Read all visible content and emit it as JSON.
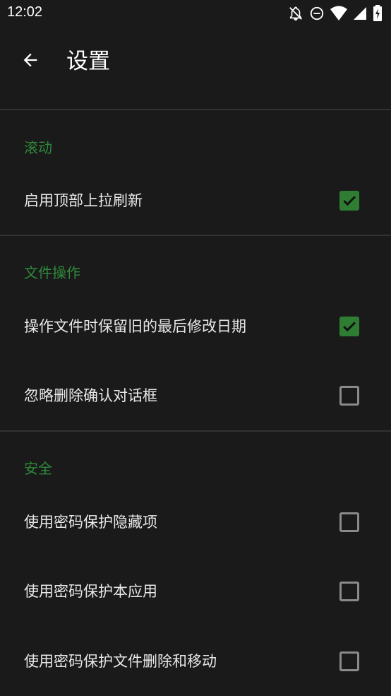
{
  "status_bar": {
    "time": "12:02",
    "icons": [
      "notifications-off-icon",
      "do-not-disturb-icon",
      "wifi-icon",
      "cell-signal-icon",
      "battery-charging-icon"
    ]
  },
  "app_bar": {
    "title": "设置",
    "back_icon": "arrow-back-icon"
  },
  "colors": {
    "background": "#1a1a1a",
    "accent": "#2f8a3b",
    "checkbox_checked": "#2e7d32",
    "divider": "#323232"
  },
  "sections": [
    {
      "header": "滚动",
      "items": [
        {
          "label": "启用顶部上拉刷新",
          "checked": true
        }
      ]
    },
    {
      "header": "文件操作",
      "items": [
        {
          "label": "操作文件时保留旧的最后修改日期",
          "checked": true
        },
        {
          "label": "忽略删除确认对话框",
          "checked": false
        }
      ]
    },
    {
      "header": "安全",
      "items": [
        {
          "label": "使用密码保护隐藏项",
          "checked": false
        },
        {
          "label": "使用密码保护本应用",
          "checked": false
        },
        {
          "label": "使用密码保护文件删除和移动",
          "checked": false
        }
      ]
    }
  ]
}
